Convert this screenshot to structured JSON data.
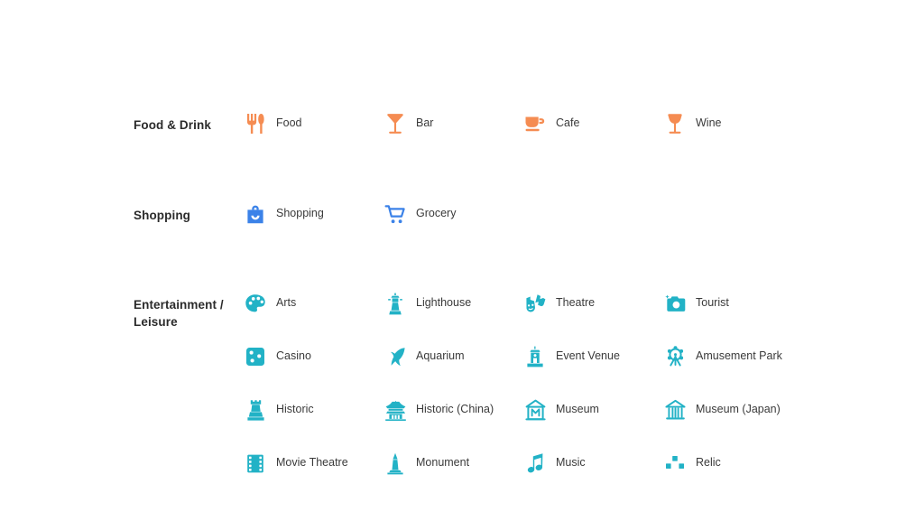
{
  "colors": {
    "food_drink": "#F58C52",
    "shopping": "#3B82E8",
    "entertainment": "#22B2C6",
    "label_text": "#3a3a3a",
    "category_text": "#2b2b2b",
    "background": "#ffffff"
  },
  "categories": [
    {
      "label": "Food & Drink",
      "color_key": "food_drink",
      "rows": [
        [
          {
            "icon": "fork-knife-icon",
            "label": "Food"
          },
          {
            "icon": "cocktail-glass-icon",
            "label": "Bar"
          },
          {
            "icon": "coffee-cup-icon",
            "label": "Cafe"
          },
          {
            "icon": "wine-glass-icon",
            "label": "Wine"
          }
        ]
      ]
    },
    {
      "label": "Shopping",
      "color_key": "shopping",
      "rows": [
        [
          {
            "icon": "shopping-bag-icon",
            "label": "Shopping"
          },
          {
            "icon": "shopping-cart-icon",
            "label": "Grocery"
          },
          {
            "icon": "",
            "label": ""
          },
          {
            "icon": "",
            "label": ""
          }
        ]
      ]
    },
    {
      "label": "Entertainment / Leisure",
      "color_key": "entertainment",
      "rows": [
        [
          {
            "icon": "paint-palette-icon",
            "label": "Arts"
          },
          {
            "icon": "lighthouse-icon",
            "label": "Lighthouse"
          },
          {
            "icon": "theatre-masks-icon",
            "label": "Theatre"
          },
          {
            "icon": "camera-sparkle-icon",
            "label": "Tourist"
          }
        ],
        [
          {
            "icon": "dice-icon",
            "label": "Casino"
          },
          {
            "icon": "dolphin-icon",
            "label": "Aquarium"
          },
          {
            "icon": "event-venue-icon",
            "label": "Event Venue"
          },
          {
            "icon": "ferris-wheel-icon",
            "label": "Amusement Park"
          }
        ],
        [
          {
            "icon": "castle-tower-icon",
            "label": "Historic"
          },
          {
            "icon": "pagoda-icon",
            "label": "Historic (China)"
          },
          {
            "icon": "museum-m-icon",
            "label": "Museum"
          },
          {
            "icon": "museum-columns-icon",
            "label": "Museum (Japan)"
          }
        ],
        [
          {
            "icon": "film-strip-icon",
            "label": "Movie Theatre"
          },
          {
            "icon": "obelisk-icon",
            "label": "Monument"
          },
          {
            "icon": "music-note-icon",
            "label": "Music"
          },
          {
            "icon": "relic-blocks-icon",
            "label": "Relic"
          }
        ]
      ]
    }
  ]
}
